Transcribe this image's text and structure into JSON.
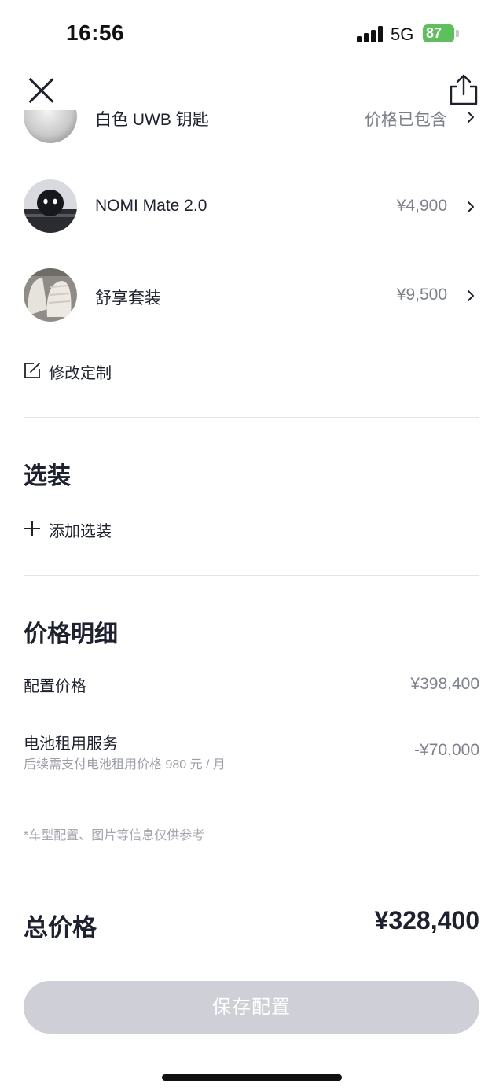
{
  "status_bar": {
    "time": "16:56",
    "network": "5G",
    "battery": "87"
  },
  "items": [
    {
      "name": "白色 UWB 钥匙",
      "price": "价格已包含",
      "icon": "uwb-key-thumbnail"
    },
    {
      "name": "NOMI Mate 2.0",
      "price": "¥4,900",
      "icon": "nomi-mate-thumbnail"
    },
    {
      "name": "舒享套装",
      "price": "¥9,500",
      "icon": "comfort-package-thumbnail"
    }
  ],
  "modify": {
    "label": "修改定制",
    "icon": "edit-icon"
  },
  "options": {
    "title": "选装",
    "add_label": "添加选装",
    "icon": "plus-icon"
  },
  "price_detail": {
    "title": "价格明细",
    "config_label": "配置价格",
    "config_value": "¥398,400",
    "battery_label": "电池租用服务",
    "battery_sub": "后续需支付电池租用价格 980 元 / 月",
    "battery_value": "-¥70,000",
    "note": "*车型配置、图片等信息仅供参考"
  },
  "total": {
    "label": "总价格",
    "value": "¥328,400"
  },
  "save_button": "保存配置",
  "colors": {
    "text_primary": "#1e2230",
    "text_secondary": "#7d818c",
    "button_disabled": "#cfd0d7",
    "battery_green": "#5cc15a"
  }
}
